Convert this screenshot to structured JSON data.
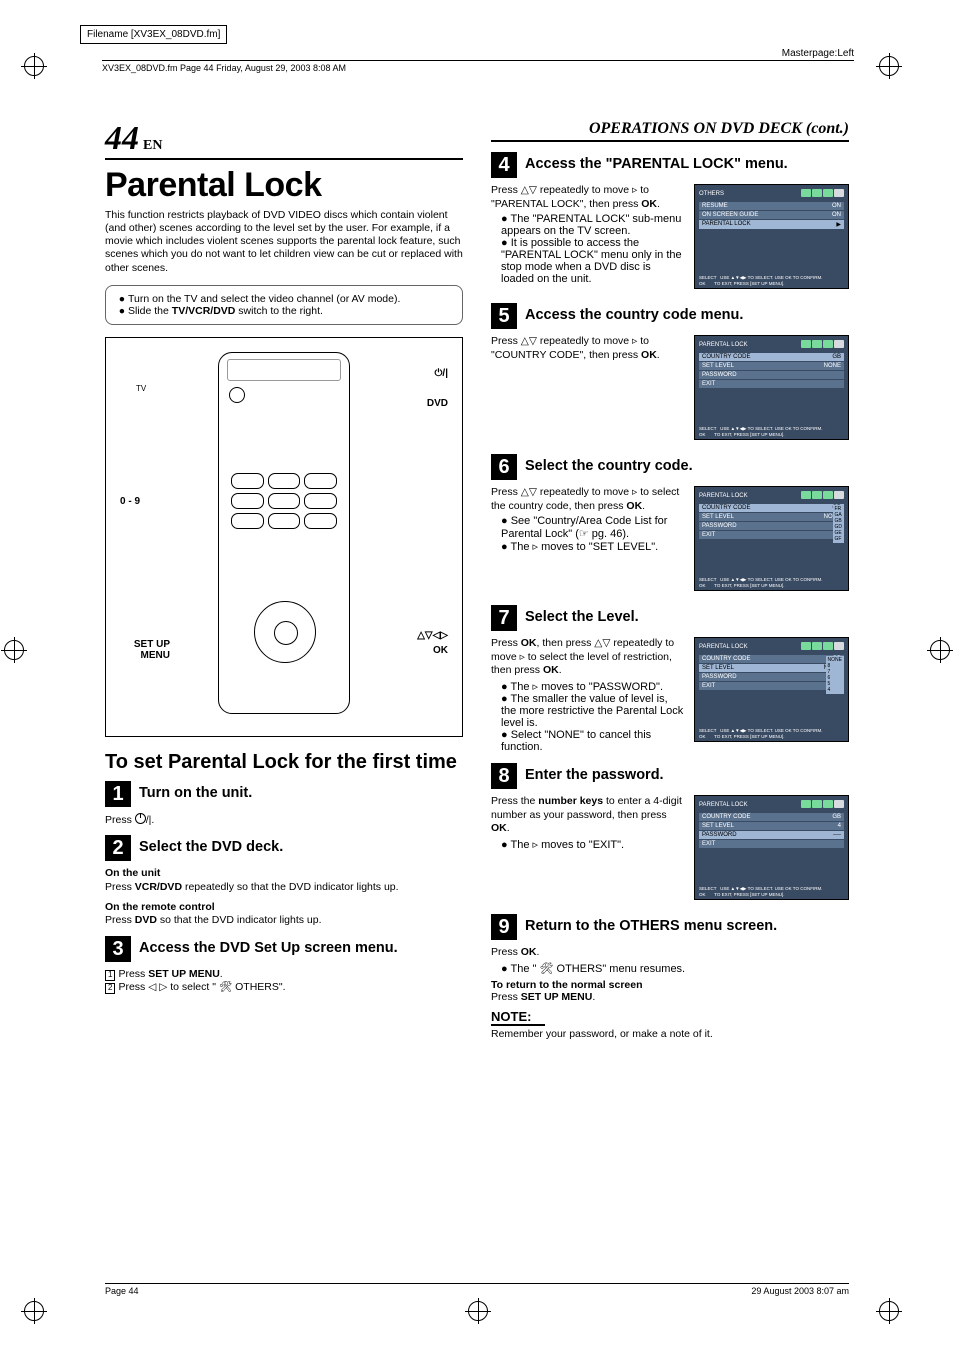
{
  "meta": {
    "filename_label": "Filename [XV3EX_08DVD.fm]",
    "header_stamp": "XV3EX_08DVD.fm  Page 44  Friday, August 29, 2003  8:08 AM",
    "masterpage": "Masterpage:Left",
    "footer_page": "Page 44",
    "footer_stamp": "29 August 2003  8:07 am"
  },
  "page_number": "44",
  "page_number_suffix": "EN",
  "right_header": "OPERATIONS ON DVD DECK (cont.)",
  "main_title": "Parental Lock",
  "intro": "This function restricts playback of DVD VIDEO discs which contain violent (and other) scenes according to the level set by the user. For example, if a movie which includes violent scenes supports the parental lock feature, such scenes which you do not want to let children view can be cut or replaced with other scenes.",
  "prep": [
    "Turn on the TV and select the video channel (or AV mode).",
    "Slide the TV/VCR/DVD switch to the right."
  ],
  "remote_labels": {
    "power": "⏻/|",
    "dvd": "DVD",
    "num": "0 - 9",
    "arrows": "△▽◁▷",
    "ok": "OK",
    "setup": "SET UP MENU"
  },
  "subheading": "To set Parental Lock for the first time",
  "steps_left": [
    {
      "n": "1",
      "title": "Turn on the unit.",
      "body": "Press ⏻/|."
    },
    {
      "n": "2",
      "title": "Select the DVD deck.",
      "sub1_h": "On the unit",
      "sub1_b": "Press VCR/DVD repeatedly so that the DVD indicator lights up.",
      "sub2_h": "On the remote control",
      "sub2_b": "Press DVD so that the DVD indicator lights up."
    },
    {
      "n": "3",
      "title": "Access the DVD Set Up screen menu.",
      "l1": "Press SET UP MENU.",
      "l2": "Press ◁ ▷ to select \" 🛠 OTHERS\"."
    }
  ],
  "steps_right": [
    {
      "n": "4",
      "title": "Access the \"PARENTAL LOCK\" menu.",
      "body": "Press △▽ repeatedly to move ▹ to \"PARENTAL LOCK\", then press OK.",
      "bullets": [
        "The \"PARENTAL LOCK\" sub-menu appears on the TV screen.",
        "It is possible to access the \"PARENTAL LOCK\" menu only in the stop mode when a DVD disc is loaded on the unit."
      ],
      "osd": {
        "title": "OTHERS",
        "rows": [
          [
            "RESUME",
            "ON"
          ],
          [
            "ON SCREEN GUIDE",
            "ON"
          ],
          [
            "PARENTAL LOCK",
            "▶"
          ]
        ],
        "hi": 2
      }
    },
    {
      "n": "5",
      "title": "Access the country code menu.",
      "body": "Press △▽ repeatedly to move ▹ to \"COUNTRY CODE\", then press OK.",
      "osd": {
        "title": "PARENTAL LOCK",
        "rows": [
          [
            "COUNTRY CODE",
            "GB"
          ],
          [
            "SET LEVEL",
            "NONE"
          ],
          [
            "PASSWORD",
            ""
          ],
          [
            "EXIT",
            ""
          ]
        ],
        "hi": 0
      }
    },
    {
      "n": "6",
      "title": "Select the country code.",
      "body": "Press △▽ repeatedly to move ▹ to select the country code, then press OK.",
      "bullets": [
        "See \"Country/Area Code List for Parental Lock\" (☞ pg. 46).",
        "The ▹ moves to \"SET LEVEL\"."
      ],
      "osd": {
        "title": "PARENTAL LOCK",
        "rows": [
          [
            "COUNTRY CODE",
            "GB"
          ],
          [
            "SET LEVEL",
            "NONE"
          ],
          [
            "PASSWORD",
            ""
          ],
          [
            "EXIT",
            ""
          ]
        ],
        "hi": 0,
        "side": [
          "FR",
          "GA",
          "GB",
          "GD",
          "GE",
          "GF"
        ]
      }
    },
    {
      "n": "7",
      "title": "Select the Level.",
      "body": "Press OK, then press △▽ repeatedly to move ▹ to select the level of restriction, then press OK.",
      "bullets": [
        "The ▹ moves to \"PASSWORD\".",
        "The smaller the value of level is, the more restrictive the Parental Lock level is.",
        "Select \"NONE\" to cancel this function."
      ],
      "osd": {
        "title": "PARENTAL LOCK",
        "rows": [
          [
            "COUNTRY CODE",
            "GB"
          ],
          [
            "SET LEVEL",
            "NONE"
          ],
          [
            "PASSWORD",
            ""
          ],
          [
            "EXIT",
            ""
          ]
        ],
        "hi": 1,
        "side": [
          "NONE",
          "8",
          "7",
          "6",
          "5",
          "4"
        ]
      }
    },
    {
      "n": "8",
      "title": "Enter the password.",
      "body": "Press the number keys to enter a 4-digit number as your password, then press OK.",
      "bullets": [
        "The ▹ moves to \"EXIT\"."
      ],
      "osd": {
        "title": "PARENTAL LOCK",
        "rows": [
          [
            "COUNTRY CODE",
            "GB"
          ],
          [
            "SET LEVEL",
            "4"
          ],
          [
            "PASSWORD",
            "----"
          ],
          [
            "EXIT",
            ""
          ]
        ],
        "hi": 2
      }
    },
    {
      "n": "9",
      "title": "Return to the OTHERS menu screen.",
      "body": "Press OK.",
      "bullets": [
        "The \" 🛠 OTHERS\" menu resumes."
      ],
      "tail_h": "To return to the normal screen",
      "tail_b": "Press SET UP MENU."
    }
  ],
  "note_heading": "NOTE:",
  "note_body": "Remember your password, or make a note of it."
}
